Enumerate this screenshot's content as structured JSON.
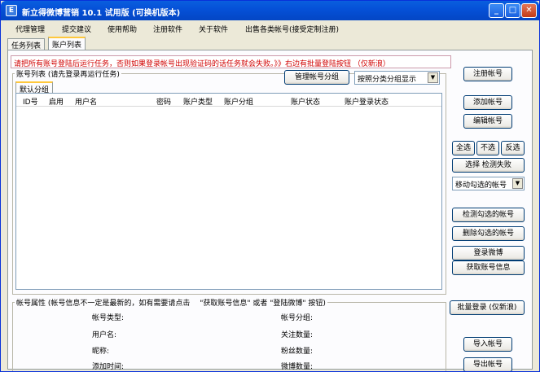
{
  "window": {
    "title": "新立得微博营销 10.1 试用版 (可换机版本)",
    "app_icon": "E"
  },
  "menu": [
    "代理管理",
    "提交建议",
    "使用帮助",
    "注册软件",
    "关于软件",
    "出售各类帐号(接受定制注册)"
  ],
  "tabs": [
    "任务列表",
    "账户列表"
  ],
  "notice": "请把所有账号登陆后运行任务，否则如果登录帐号出现验证码的话任务就会失败。》》右边有批量登陆按钮 （仅新浪）",
  "account_list": {
    "group_label": "账号列表 (请先登录再运行任务)",
    "manage_groups_button": "管理帐号分组",
    "display_select": "按照分类分组显示",
    "subtab": "默认分组",
    "columns": [
      "ID号",
      "启用",
      "用户名",
      "密码",
      "账户类型",
      "账户分组",
      "账户状态",
      "账户登录状态"
    ]
  },
  "right_panel": {
    "register_account": "注册帐号",
    "add_account": "添加帐号",
    "edit_account": "编辑帐号",
    "select_all": "全选",
    "select_none": "不选",
    "invert": "反选",
    "select_failed": "选择 检测失败",
    "move_checked": "移动勾选的帐号",
    "check_checked": "检测勾选的帐号",
    "delete_checked": "删除勾选的帐号",
    "login_weibo": "登录微博",
    "fetch_info": "获取账号信息",
    "batch_login": "批量登录 (仅新浪)",
    "import_accounts": "导入帐号",
    "export_accounts": "导出帐号"
  },
  "properties": {
    "group_label": "帐号属性 (帐号信息不一定是最新的，如有需要请点击 　\"获取账号信息\" 或者 \"登陆微博\" 按钮)",
    "account_type": "帐号类型:",
    "username": "用户名:",
    "nickname": "昵称:",
    "add_time": "添加时间:",
    "account_group": "帐号分组:",
    "follow_count": "关注数量:",
    "fans_count": "粉丝数量:",
    "weibo_count": "微博数量:"
  }
}
